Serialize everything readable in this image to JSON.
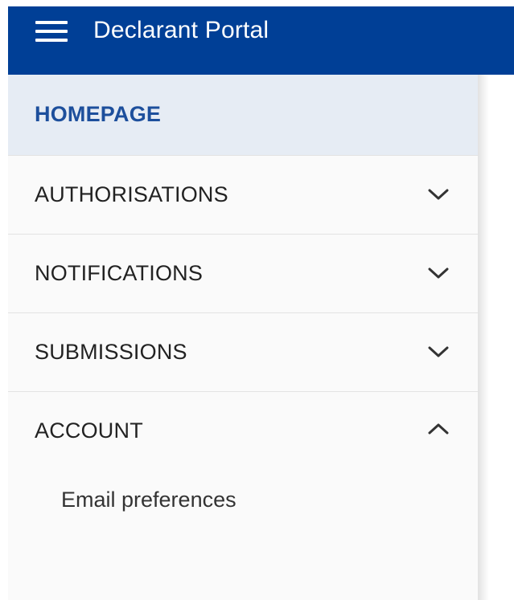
{
  "header": {
    "menu_icon": "hamburger-menu-icon",
    "title": "Declarant Portal",
    "background": "#003f96"
  },
  "sidebar": {
    "items": [
      {
        "label": "HOMEPAGE",
        "active": true,
        "chevron": null
      },
      {
        "label": "AUTHORISATIONS",
        "active": false,
        "chevron": "chevron-down-icon"
      },
      {
        "label": "NOTIFICATIONS",
        "active": false,
        "chevron": "chevron-down-icon"
      },
      {
        "label": "SUBMISSIONS",
        "active": false,
        "chevron": "chevron-down-icon"
      },
      {
        "label": "ACCOUNT",
        "active": false,
        "chevron": "chevron-up-icon",
        "expanded": true,
        "children": [
          {
            "label": "Email preferences"
          }
        ]
      }
    ],
    "active_bg": "#e6ecf4",
    "active_text": "#1d4f9c"
  }
}
